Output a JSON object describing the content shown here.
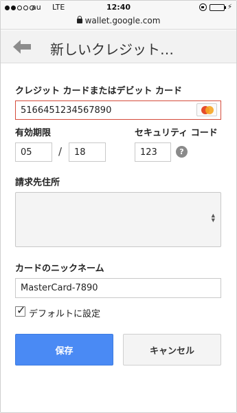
{
  "status_bar": {
    "carrier": "au",
    "network": "LTE",
    "time": "12:40",
    "signal_strength": 2
  },
  "url_bar": {
    "url": "wallet.google.com"
  },
  "header": {
    "title": "新しいクレジット…"
  },
  "form": {
    "card_number": {
      "label": "クレジット カードまたはデビット カード",
      "value": "5166451234567890",
      "card_brand": "MasterCard"
    },
    "expiry": {
      "label": "有効期限",
      "month": "05",
      "separator": "/",
      "year": "18"
    },
    "security_code": {
      "label": "セキュリティ コード",
      "value": "123",
      "help_symbol": "?"
    },
    "billing_address": {
      "label": "請求先住所",
      "value": ""
    },
    "nickname": {
      "label": "カードのニックネーム",
      "value": "MasterCard-7890"
    },
    "default_checkbox": {
      "label": "デフォルトに設定",
      "checked": true
    }
  },
  "actions": {
    "save_label": "保存",
    "cancel_label": "キャンセル"
  },
  "colors": {
    "primary_button": "#4a8af4",
    "error_border": "#d44a3a"
  }
}
